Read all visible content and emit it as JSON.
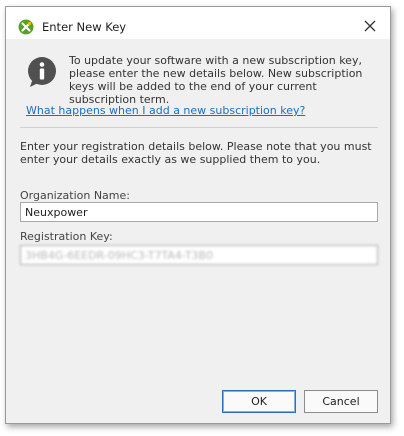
{
  "window": {
    "title": "Enter New Key",
    "icons": {
      "app": "app-logo-icon",
      "close": "close-icon",
      "info": "info-icon"
    }
  },
  "info": {
    "text": "To update your software with a new subscription key, please enter the new details below. New subscription keys will be added to the end of your current subscription term."
  },
  "help_link": "What happens when I add a new subscription key?",
  "details": {
    "text": "Enter your registration details below. Please note that you must enter your details exactly as we supplied them to you."
  },
  "form": {
    "organization_label": "Organization Name:",
    "organization_value": "Neuxpower",
    "key_label": "Registration Key:",
    "key_value": "3HB4G-6EEDR-09HC3-T7TA4-T3B0"
  },
  "buttons": {
    "ok": "OK",
    "cancel": "Cancel"
  },
  "colors": {
    "accent": "#1a6fbf",
    "logo_green": "#5aa02c",
    "dialog_bg": "#f0f0f0"
  }
}
